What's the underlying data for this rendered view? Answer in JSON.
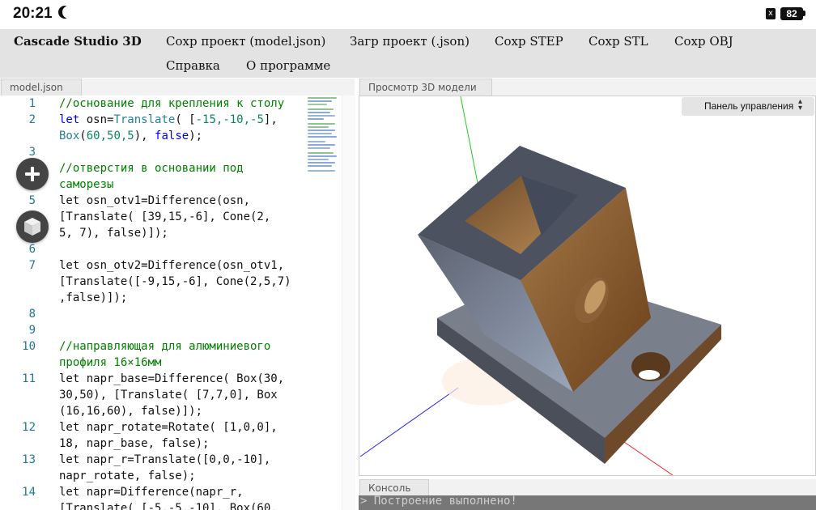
{
  "status_bar": {
    "time": "20:21",
    "sim_icon": "x",
    "battery": "82"
  },
  "menu": {
    "brand": "Cascade Studio 3D",
    "items": [
      "Сохр проект (model.json)",
      "Загр проект (.json)",
      "Сохр STEP",
      "Сохр STL",
      "Сохр OBJ",
      "Справка",
      "О программе"
    ]
  },
  "editor": {
    "tab": "model.json",
    "line_numbers": [
      "1",
      "2",
      "3",
      "4",
      "5",
      "6",
      "7",
      "8",
      "9",
      "10",
      "11",
      "12",
      "13",
      "14"
    ],
    "lines": {
      "l1": "//основание для крепления к столу",
      "l2a_kw": "let",
      "l2a_rest": " osn=",
      "l2a_fn": "Translate",
      "l2a_args": "( [",
      "l2a_n": "-15,-10,-5",
      "l2a_end": "],",
      "l2b_fn": "Box",
      "l2b_n": "60,50,5",
      "l2b_kw": "false",
      "l4a": "//отверстия в основании под",
      "l4b": "саморезы",
      "l5a": "let osn_otv1=Difference(osn,",
      "l5b": "[Translate( [39,15,-6], Cone(2,",
      "l5c": "5, 7), false)]);",
      "l7a": "let osn_otv2=Difference(osn_otv1,",
      "l7b": "[Translate([-9,15,-6], Cone(2,5,7)",
      "l7c": ",false)]);",
      "l10a": "//направляющая для алюминиевого",
      "l10b": "профиля 16×16мм",
      "l11a": "let napr_base=Difference( Box(30,",
      "l11b": "30,50), [Translate( [7,7,0], Box",
      "l11c": "(16,16,60), false)]);",
      "l12a": "let napr_rotate=Rotate( [1,0,0],",
      "l12b": "18, napr_base, false);",
      "l13a": "let napr_r=Translate([0,0,-10],",
      "l13b": "napr_rotate, false);",
      "l14a": "let napr=Difference(napr_r,",
      "l14b": "[Translate( [-5,-5,-10], Box(60,"
    }
  },
  "viewport": {
    "tab": "Просмотр 3D модели",
    "control_panel": "Панель управления"
  },
  "console": {
    "tab": "Консоль",
    "output": "> Построение выполнено!"
  },
  "colors": {
    "comment": "#008000",
    "keyword": "#0000ff",
    "function": "#267f99",
    "number": "#098658",
    "line_number": "#237893",
    "menubar": "#e3e3e3"
  }
}
